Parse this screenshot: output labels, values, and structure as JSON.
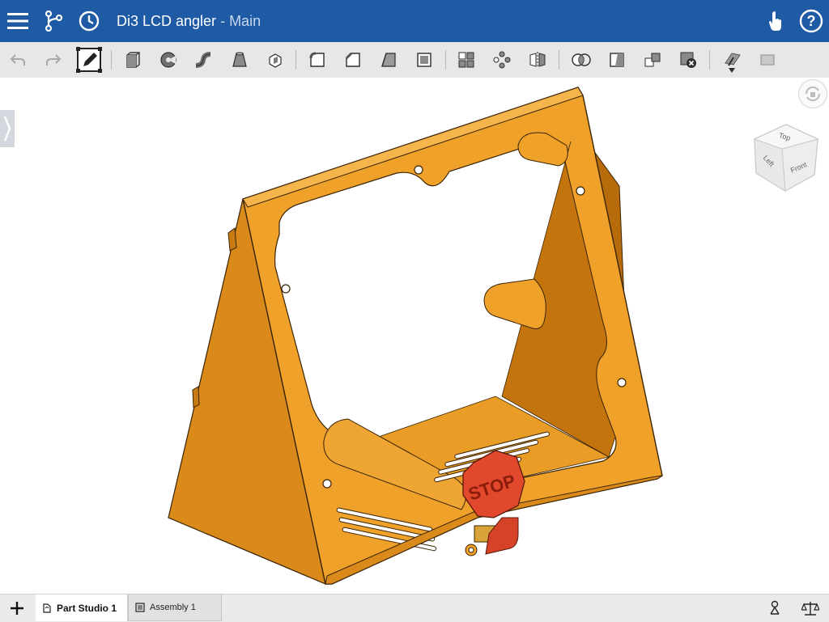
{
  "header": {
    "doc_title": "Di3 LCD angler",
    "separator": " - ",
    "branch": "Main",
    "bg_color": "#1f5aa5",
    "menu_icon": "hamburger-menu-icon",
    "versions_icon": "branch-versions-icon",
    "history_icon": "clock-history-icon",
    "touch_icon": "touch-hand-icon",
    "help_icon": "help-circle-icon"
  },
  "toolbar": {
    "tools": [
      {
        "name": "undo-icon"
      },
      {
        "name": "redo-icon"
      },
      {
        "name": "sketch-icon"
      },
      {
        "name": "extrude-icon"
      },
      {
        "name": "revolve-icon"
      },
      {
        "name": "sweep-icon"
      },
      {
        "name": "loft-icon"
      },
      {
        "name": "thicken-icon"
      },
      {
        "name": "fillet-icon"
      },
      {
        "name": "chamfer-icon"
      },
      {
        "name": "draft-icon"
      },
      {
        "name": "shell-icon"
      },
      {
        "name": "linear-pattern-icon"
      },
      {
        "name": "circular-pattern-icon"
      },
      {
        "name": "mirror-icon"
      },
      {
        "name": "boolean-icon"
      },
      {
        "name": "split-icon"
      },
      {
        "name": "transform-icon"
      },
      {
        "name": "delete-part-icon"
      },
      {
        "name": "plane-icon"
      },
      {
        "name": "sheet-icon"
      }
    ]
  },
  "viewport": {
    "part_color": "#f0a12a",
    "stop_label": "STOP",
    "stop_color": "#e2482c"
  },
  "viewcube": {
    "top": "Top",
    "left": "Left",
    "front": "Front"
  },
  "tabs": [
    {
      "label": "Part Studio 1",
      "active": true
    },
    {
      "label": "Assembly 1",
      "active": false
    }
  ],
  "bottom_right_icons": [
    "mate-connector-icon",
    "balance-scale-icon"
  ]
}
